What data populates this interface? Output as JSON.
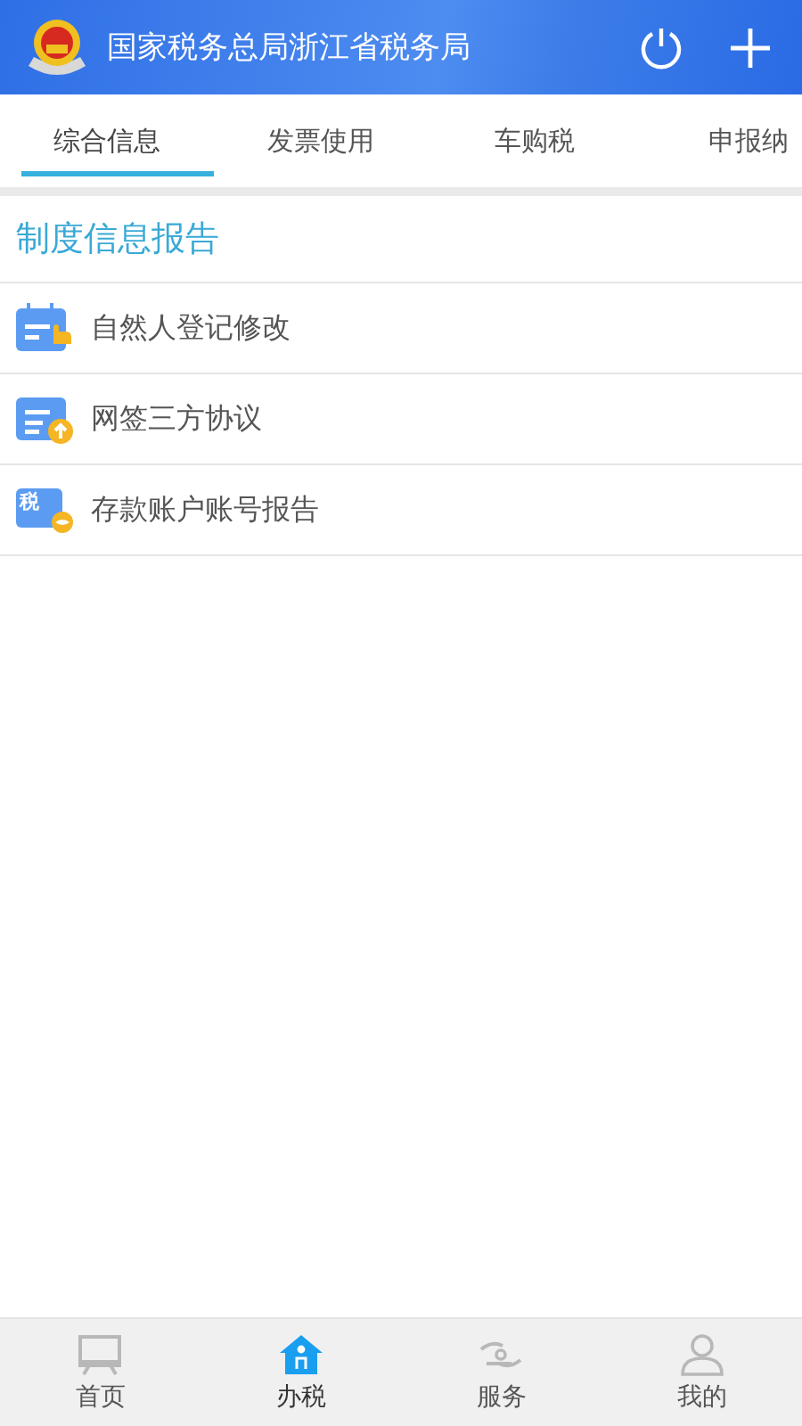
{
  "header": {
    "title": "国家税务总局浙江省税务局"
  },
  "tabs": [
    {
      "label": "综合信息",
      "selected": true
    },
    {
      "label": "发票使用",
      "selected": false
    },
    {
      "label": "车购税",
      "selected": false
    },
    {
      "label": "申报纳",
      "selected": false
    }
  ],
  "section": {
    "title": "制度信息报告"
  },
  "items": [
    {
      "label": "自然人登记修改",
      "kind": "calendar"
    },
    {
      "label": "网签三方协议",
      "kind": "upload"
    },
    {
      "label": "存款账户账号报告",
      "kind": "tax",
      "icon_text": "税"
    }
  ],
  "bottom_nav": [
    {
      "label": "首页",
      "kind": "screen",
      "selected": false
    },
    {
      "label": "办税",
      "kind": "house",
      "selected": true
    },
    {
      "label": "服务",
      "kind": "hand",
      "selected": false
    },
    {
      "label": "我的",
      "kind": "person",
      "selected": false
    }
  ]
}
